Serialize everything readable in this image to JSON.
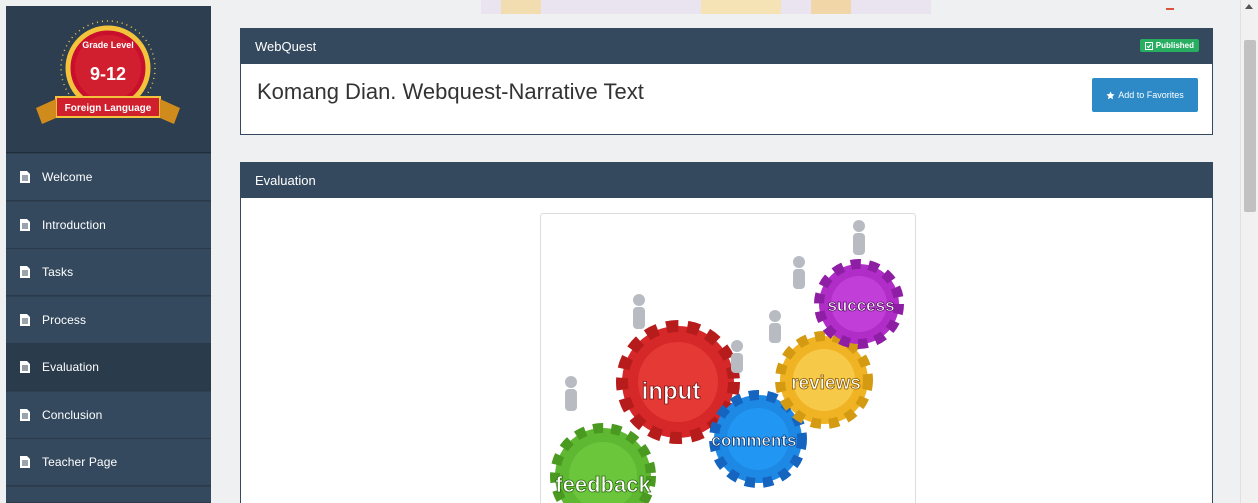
{
  "logo": {
    "grade_label": "Grade Level",
    "grade_range": "9-12",
    "subject": "Foreign Language"
  },
  "sidebar": {
    "items": [
      {
        "label": "Welcome",
        "icon": "document-icon"
      },
      {
        "label": "Introduction",
        "icon": "document-icon"
      },
      {
        "label": "Tasks",
        "icon": "document-icon"
      },
      {
        "label": "Process",
        "icon": "document-icon"
      },
      {
        "label": "Evaluation",
        "icon": "document-icon",
        "active": true
      },
      {
        "label": "Conclusion",
        "icon": "document-icon"
      },
      {
        "label": "Teacher Page",
        "icon": "document-icon"
      }
    ]
  },
  "webquest": {
    "header": "WebQuest",
    "status": "Published",
    "title": "Komang Dian. Webquest-Narrative Text",
    "favorites_label": "Add to Favorites"
  },
  "evaluation": {
    "header": "Evaluation",
    "gears": [
      "feedback",
      "input",
      "comments",
      "reviews",
      "success"
    ]
  },
  "colors": {
    "sidebar": "#34495e",
    "panel_header": "#34495e",
    "published": "#27ae60",
    "favorites": "#2d8ac7"
  }
}
